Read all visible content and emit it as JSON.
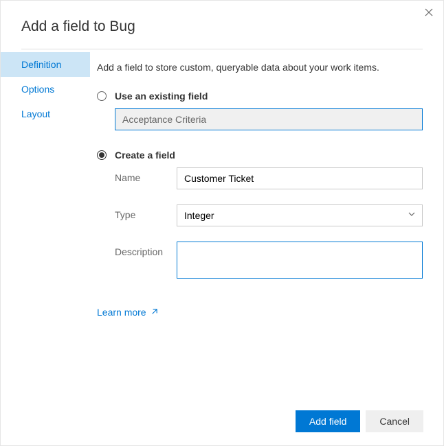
{
  "header": {
    "title": "Add a field to Bug"
  },
  "sidebar": {
    "items": [
      {
        "label": "Definition"
      },
      {
        "label": "Options"
      },
      {
        "label": "Layout"
      }
    ]
  },
  "main": {
    "intro": "Add a field to store custom, queryable data about your work items.",
    "existing": {
      "label": "Use an existing field",
      "value": "Acceptance Criteria"
    },
    "create": {
      "label": "Create a field",
      "name_label": "Name",
      "name_value": "Customer Ticket",
      "type_label": "Type",
      "type_value": "Integer",
      "desc_label": "Description",
      "desc_value": ""
    },
    "learn_more": "Learn more"
  },
  "footer": {
    "primary": "Add field",
    "secondary": "Cancel"
  }
}
